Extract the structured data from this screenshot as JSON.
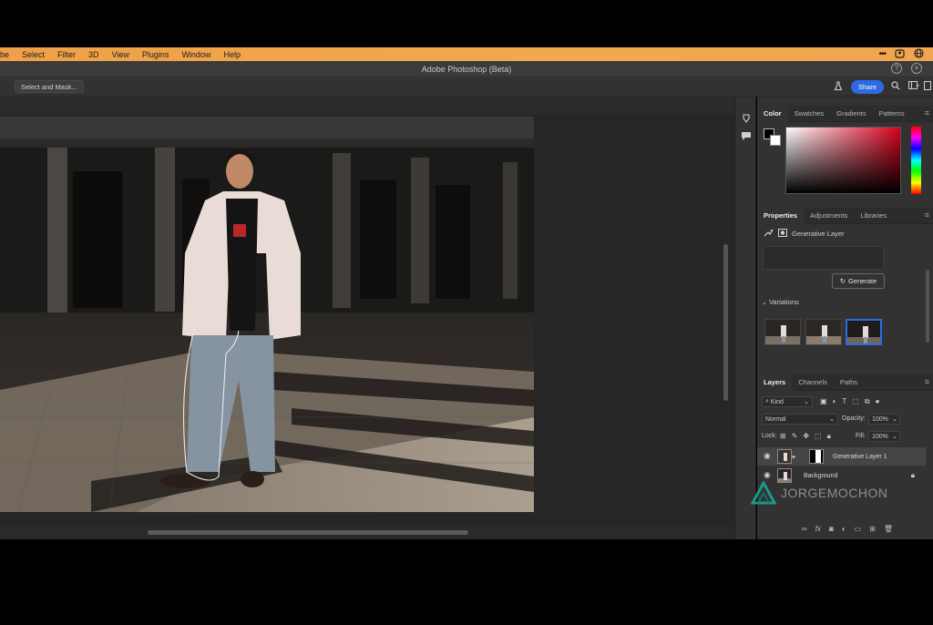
{
  "menubar": {
    "items": [
      "be",
      "Select",
      "Filter",
      "3D",
      "View",
      "Plugins",
      "Window",
      "Help"
    ],
    "right_icons": [
      "more-icon",
      "account-icon",
      "globe-icon"
    ]
  },
  "titlebar": {
    "title": "Adobe Photoshop (Beta)"
  },
  "options_bar": {
    "select_and_mask_label": "Select and Mask...",
    "share_label": "Share"
  },
  "color_panel": {
    "tabs": [
      "Color",
      "Swatches",
      "Gradients",
      "Patterns"
    ],
    "active_tab": "Color",
    "foreground": "#000000",
    "background": "#ffffff",
    "hue": "#d6001c"
  },
  "properties_panel": {
    "tabs": [
      "Properties",
      "Adjustments",
      "Libraries"
    ],
    "active_tab": "Properties",
    "layer_type": "Generative Layer",
    "generate_label": "Generate",
    "variations_label": "Variations",
    "selected_variation": 3
  },
  "layers_panel": {
    "tabs": [
      "Layers",
      "Channels",
      "Paths"
    ],
    "active_tab": "Layers",
    "filter": "Kind",
    "blend_mode": "Normal",
    "opacity_label": "Opacity:",
    "opacity_value": "100%",
    "lock_label": "Lock:",
    "fill_label": "Fill:",
    "fill_value": "100%",
    "layers": [
      {
        "name": "Generative Layer 1",
        "selected": true
      },
      {
        "name": "Background",
        "selected": false
      }
    ]
  },
  "watermark": {
    "text": "JORGEMOCHON"
  },
  "accent_color": "#2d6be4"
}
